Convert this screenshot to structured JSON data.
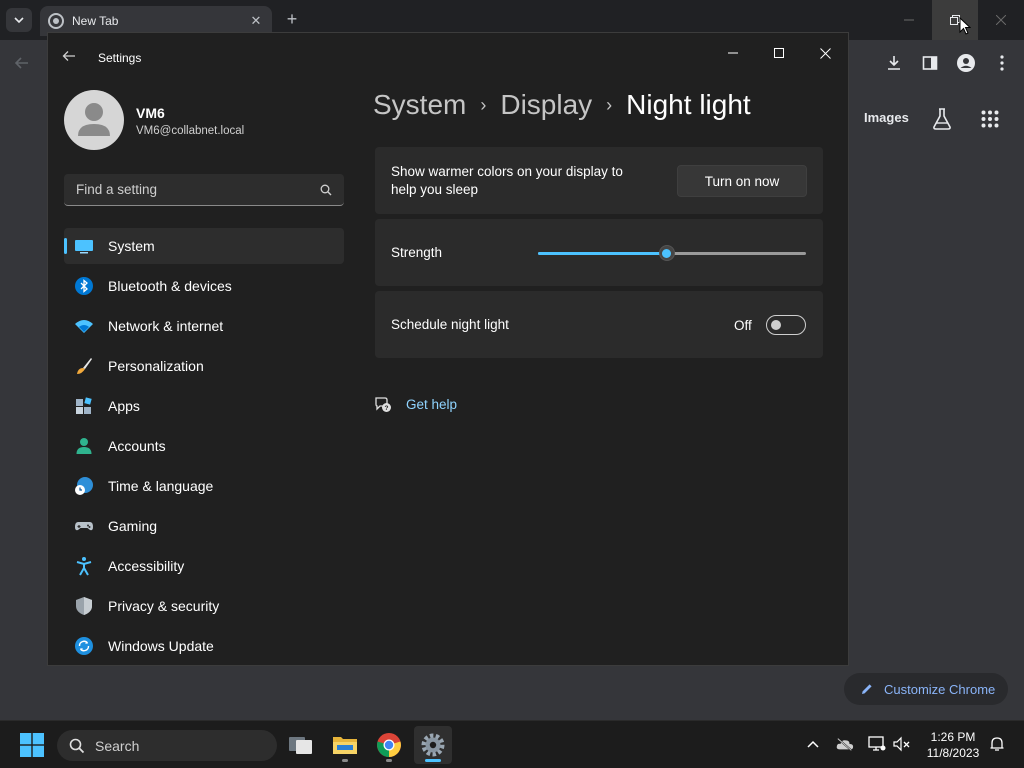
{
  "chrome": {
    "tab_title": "New Tab",
    "images_link": "Images",
    "customize_label": "Customize Chrome"
  },
  "settings": {
    "window_title": "Settings",
    "user": {
      "name": "VM6",
      "email": "VM6@collabnet.local"
    },
    "search_placeholder": "Find a setting",
    "nav": [
      {
        "label": "System",
        "icon": "system-icon",
        "active": true
      },
      {
        "label": "Bluetooth & devices",
        "icon": "bluetooth-icon"
      },
      {
        "label": "Network & internet",
        "icon": "wifi-icon"
      },
      {
        "label": "Personalization",
        "icon": "brush-icon"
      },
      {
        "label": "Apps",
        "icon": "apps-icon"
      },
      {
        "label": "Accounts",
        "icon": "accounts-icon"
      },
      {
        "label": "Time & language",
        "icon": "globe-clock-icon"
      },
      {
        "label": "Gaming",
        "icon": "gamepad-icon"
      },
      {
        "label": "Accessibility",
        "icon": "accessibility-icon"
      },
      {
        "label": "Privacy & security",
        "icon": "shield-icon"
      },
      {
        "label": "Windows Update",
        "icon": "update-icon"
      }
    ],
    "breadcrumb": [
      "System",
      "Display",
      "Night light"
    ],
    "night_light": {
      "description": "Show warmer colors on your display to help you sleep",
      "turn_on_label": "Turn on now",
      "strength_label": "Strength",
      "strength_fraction": 0.48,
      "schedule_label": "Schedule night light",
      "schedule_state": "Off"
    },
    "get_help_label": "Get help"
  },
  "taskbar": {
    "search_label": "Search",
    "time": "1:26 PM",
    "date": "11/8/2023"
  },
  "colors": {
    "accent": "#4cc2ff",
    "link": "#8fd4ff",
    "window_bg": "#202020",
    "card_bg": "#2b2b2b"
  }
}
